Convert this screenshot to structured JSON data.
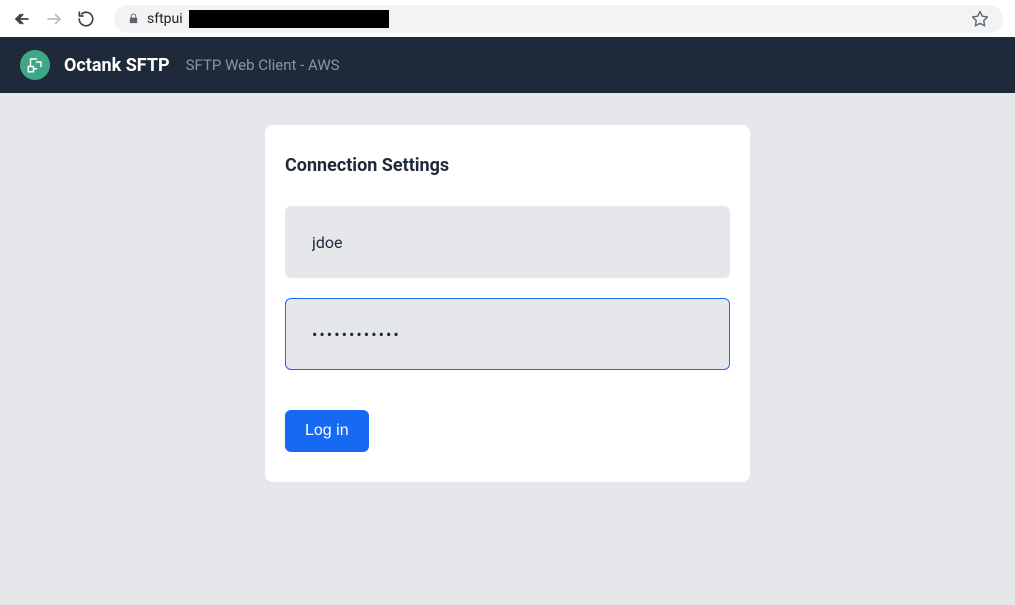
{
  "browser": {
    "url_prefix": "sftpui"
  },
  "header": {
    "app_title": "Octank SFTP",
    "app_subtitle": "SFTP Web Client - AWS"
  },
  "form": {
    "title": "Connection Settings",
    "username_value": "jdoe",
    "password_value": "••••••••••••",
    "login_label": "Log in"
  }
}
